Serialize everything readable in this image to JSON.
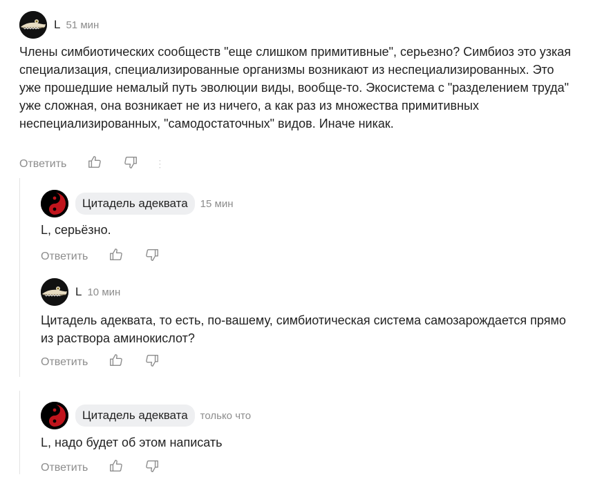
{
  "comments": [
    {
      "author": "L",
      "time": "51 мин",
      "text": "Члены симбиотических сообществ \"еще слишком примитивные\", серьезно? Симбиоз это узкая специализация, специализированные организмы возникают из неспециализированных. Это уже прошедшие немалый путь эволюции виды, вообще-то. Экосистема с \"разделением труда\" уже сложная, она возникает не из ничего, а как раз из множества примитивных неспециализированных, \"самодостаточных\" видов. Иначе никак.",
      "reply_label": "Ответить"
    },
    {
      "author": "Цитадель адеквата",
      "time": "15 мин",
      "text": "L, серьёзно.",
      "reply_label": "Ответить"
    },
    {
      "author": "L",
      "time": "10 мин",
      "text": "Цитадель адеквата, то есть, по-вашему, симбиотическая система самозарождается прямо из раствора аминокислот?",
      "reply_label": "Ответить"
    },
    {
      "author": "Цитадель адеквата",
      "time": "только что",
      "text": "L, надо будет об этом написать",
      "reply_label": "Ответить"
    }
  ],
  "icons": {
    "like": "thumbs-up-icon",
    "dislike": "thumbs-down-icon",
    "more": "more-dots-icon"
  },
  "colors": {
    "meta": "#8c8c8c",
    "pill_bg": "#eeeff1",
    "avatar_red": "#c0141c"
  }
}
